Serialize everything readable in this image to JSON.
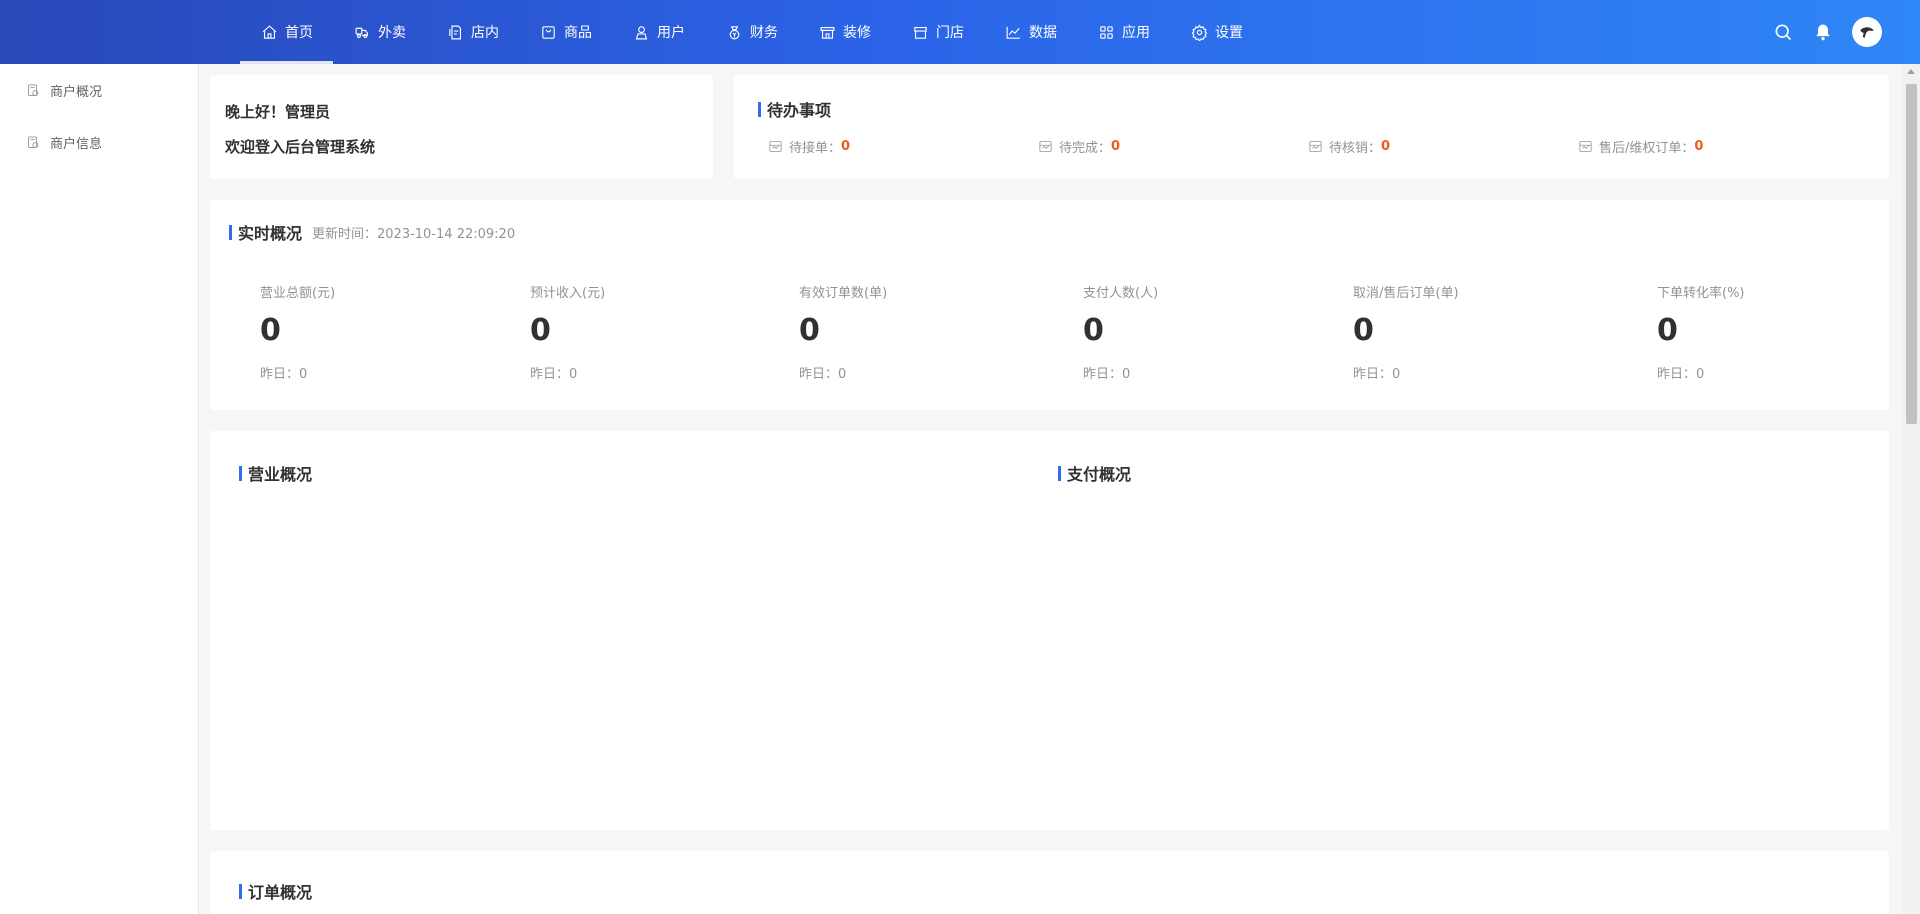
{
  "nav": {
    "items": [
      {
        "label": "首页",
        "icon": "home-icon",
        "active": true
      },
      {
        "label": "外卖",
        "icon": "delivery-icon",
        "active": false
      },
      {
        "label": "店内",
        "icon": "dine-in-icon",
        "active": false
      },
      {
        "label": "商品",
        "icon": "goods-icon",
        "active": false
      },
      {
        "label": "用户",
        "icon": "user-icon",
        "active": false
      },
      {
        "label": "财务",
        "icon": "finance-icon",
        "active": false
      },
      {
        "label": "装修",
        "icon": "decoration-icon",
        "active": false
      },
      {
        "label": "门店",
        "icon": "store-icon",
        "active": false
      },
      {
        "label": "数据",
        "icon": "data-icon",
        "active": false
      },
      {
        "label": "应用",
        "icon": "apps-icon",
        "active": false
      },
      {
        "label": "设置",
        "icon": "settings-icon",
        "active": false
      }
    ]
  },
  "topright": {
    "icons": [
      "search-icon",
      "bell-icon",
      "avatar"
    ]
  },
  "sidebar": {
    "items": [
      {
        "label": "商户概况",
        "icon": "merchant-overview-icon"
      },
      {
        "label": "商户信息",
        "icon": "merchant-info-icon"
      }
    ]
  },
  "welcome": {
    "greeting": "晚上好！管理员",
    "message": "欢迎登入后台管理系统"
  },
  "todo": {
    "title": "待办事项",
    "items": [
      {
        "label": "待接单：",
        "value": "0"
      },
      {
        "label": "待完成：",
        "value": "0"
      },
      {
        "label": "待核销：",
        "value": "0"
      },
      {
        "label": "售后/维权订单：",
        "value": "0"
      }
    ]
  },
  "realtime": {
    "title": "实时概况",
    "updated": "更新时间：2023-10-14 22:09:20",
    "stats": [
      {
        "label": "营业总额(元)",
        "value": "0",
        "yesterday": "昨日：0"
      },
      {
        "label": "预计收入(元)",
        "value": "0",
        "yesterday": "昨日：0"
      },
      {
        "label": "有效订单数(单)",
        "value": "0",
        "yesterday": "昨日：0"
      },
      {
        "label": "支付人数(人)",
        "value": "0",
        "yesterday": "昨日：0"
      },
      {
        "label": "取消/售后订单(单)",
        "value": "0",
        "yesterday": "昨日：0"
      },
      {
        "label": "下单转化率(%)",
        "value": "0",
        "yesterday": "昨日：0"
      }
    ]
  },
  "charts": {
    "business_title": "营业概况",
    "payment_title": "支付概况"
  },
  "orders": {
    "title": "订单概况"
  },
  "colors": {
    "accent": "#2f6df0",
    "highlight": "#f05a1a"
  }
}
